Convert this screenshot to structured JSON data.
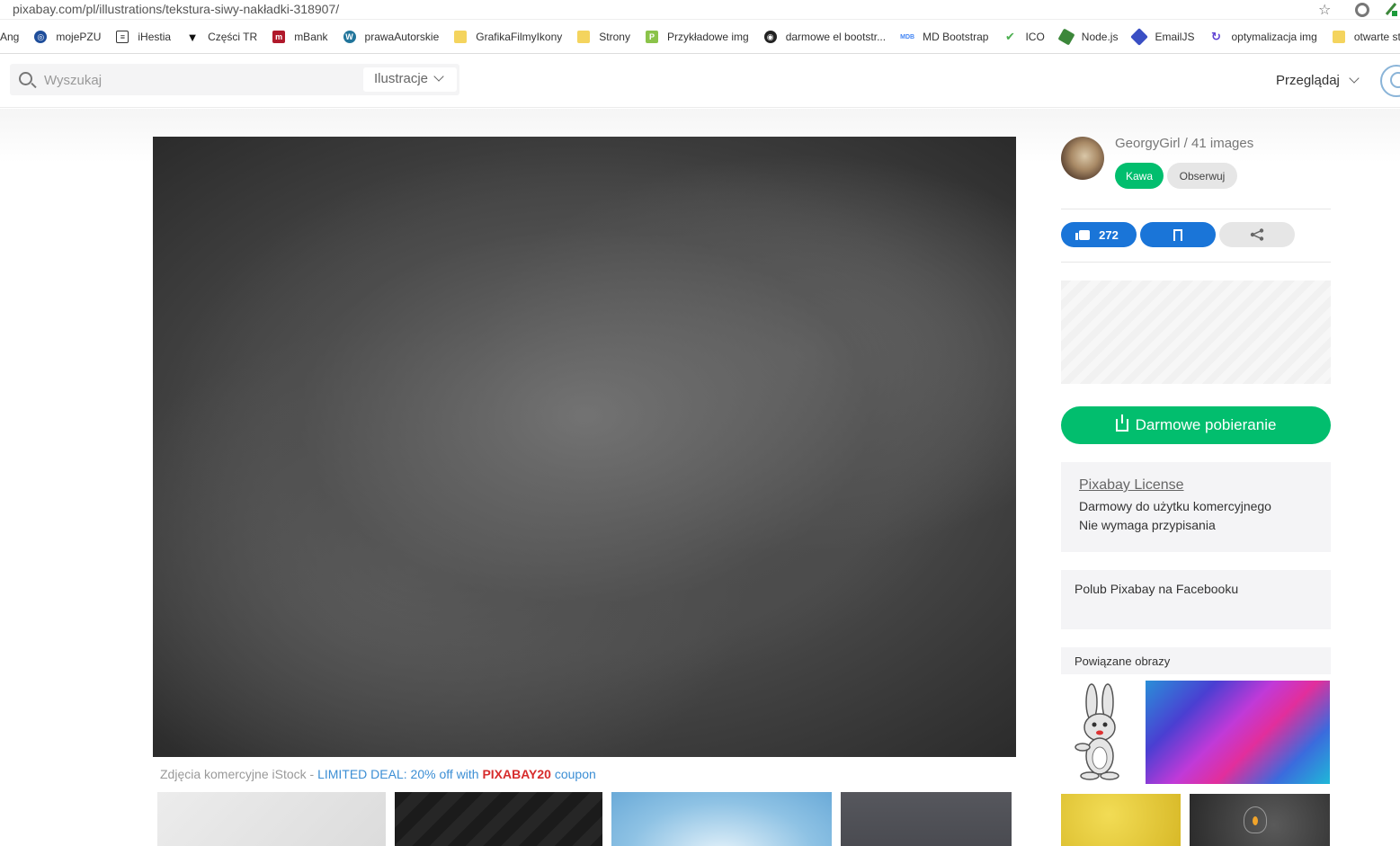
{
  "browser": {
    "url": "pixabay.com/pl/illustrations/tekstura-siwy-nakładki-318907/",
    "bookmarks": [
      {
        "label": "Ang",
        "icon": "none"
      },
      {
        "label": "mojePZU",
        "icon": "pzu-icon",
        "color": "#1f4e9b"
      },
      {
        "label": "iHestia",
        "icon": "document-icon",
        "color": "#333333"
      },
      {
        "label": "Części TR",
        "icon": "tr-logo-icon",
        "color": "#111111"
      },
      {
        "label": "mBank",
        "icon": "mbank-icon",
        "color": "#b0192b"
      },
      {
        "label": "prawaAutorskie",
        "icon": "wordpress-icon",
        "color": "#21759b"
      },
      {
        "label": "GrafikaFilmyIkony",
        "icon": "folder-icon",
        "color": "#f4d45e"
      },
      {
        "label": "Strony",
        "icon": "folder-icon",
        "color": "#f4d45e"
      },
      {
        "label": "Przykładowe img",
        "icon": "p-icon",
        "color": "#8bc34a"
      },
      {
        "label": "darmowe el bootstr...",
        "icon": "github-icon",
        "color": "#222222"
      },
      {
        "label": "MD Bootstrap",
        "icon": "mdb-icon",
        "color": "#4285f4"
      },
      {
        "label": "ICO",
        "icon": "ico-icon",
        "color": "#4caf50"
      },
      {
        "label": "Node.js",
        "icon": "nodejs-icon",
        "color": "#3c873a"
      },
      {
        "label": "EmailJS",
        "icon": "emailjs-icon",
        "color": "#3a4fc4"
      },
      {
        "label": "optymalizacja img",
        "icon": "optimize-icon",
        "color": "#5c3fd2"
      },
      {
        "label": "otwarte strony",
        "icon": "folder-icon",
        "color": "#f4d45e"
      }
    ]
  },
  "header": {
    "search_placeholder": "Wyszukaj",
    "search_type": "Ilustracje",
    "browse": "Przeglądaj"
  },
  "image": {
    "caption_prefix": "Zdjęcia komercyjne iStock - ",
    "caption_deal": "LIMITED DEAL: 20% off with ",
    "caption_code": "PIXABAY20",
    "caption_suffix": " coupon"
  },
  "sidebar": {
    "author": "GeorgyGirl / 41 images",
    "coffee_label": "Kawa",
    "follow_label": "Obserwuj",
    "likes": "272",
    "download_label": "Darmowe pobieranie",
    "license_title": "Pixabay License",
    "license_line1": "Darmowy do użytku komercyjnego",
    "license_line2": "Nie wymaga przypisania",
    "facebook_text": "Polub Pixabay na Facebooku",
    "related_title": "Powiązane obrazy"
  },
  "colors": {
    "green": "#02be6e",
    "blue": "#1a75d8",
    "deal_blue": "#3b8ed4",
    "code_red": "#d72c2c"
  }
}
